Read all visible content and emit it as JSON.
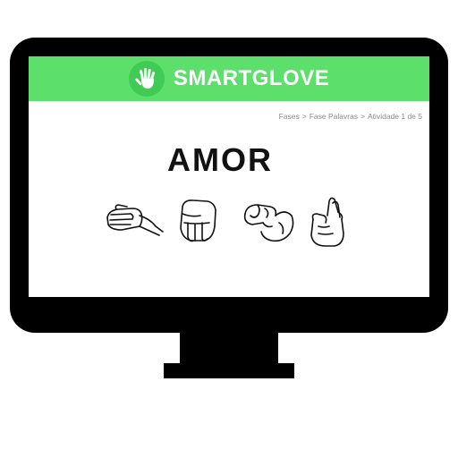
{
  "app": {
    "name": "SMARTGLOVE",
    "logo_icon": "hand-icon",
    "header_color": "#5de06b",
    "logo_badge_color": "#3fcb55"
  },
  "breadcrumb": {
    "items": [
      "Fases",
      "Fase Palavras",
      "Atividade 1 de 5"
    ],
    "separator": ">"
  },
  "exercise": {
    "word": "AMOR",
    "signs": [
      {
        "letter": "A",
        "icon": "sign-letter-a-icon"
      },
      {
        "letter": "M",
        "icon": "sign-letter-m-icon"
      },
      {
        "letter": "O",
        "icon": "sign-letter-o-icon"
      },
      {
        "letter": "R",
        "icon": "sign-letter-r-icon"
      }
    ]
  }
}
